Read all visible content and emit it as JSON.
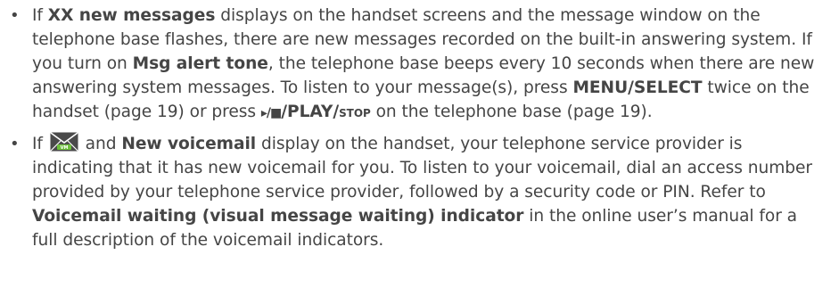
{
  "bullet_1": {
    "t1": "If ",
    "b1": "XX new messages",
    "t2": " displays on the handset screens and the message window on the telephone base flashes, there are new messages recorded on the built-in answering system. If you turn on ",
    "b2": "Msg alert tone",
    "t3": ", the telephone base beeps every 10 seconds when there are new answering system messages. To listen to your message(s), press ",
    "b3": "MENU/SELECT",
    "t4": " twice on the handset (page 19) or press ",
    "play_glyphs": "▸/■",
    "b4": "/PLAY/",
    "stop": "stop",
    "t5": " on the telephone base (page 19)."
  },
  "bullet_2": {
    "t1": "If ",
    "icon": "new-voicemail-envelope-icon",
    "t2": " and ",
    "b1": "New voicemail",
    "t3": " display on the handset, your telephone service provider is indicating that it has new voicemail for you. To listen to your voicemail, dial an access number provided by your telephone service provider, followed by a security code or PIN. Refer to ",
    "b2": "Voicemail waiting (visual message waiting) indicator",
    "t4": " in the online user’s manual for a full description of the voicemail indicators."
  },
  "colors": {
    "text": "#454545",
    "icon_bg": "#4a4a4a",
    "icon_accent": "#6cbf3a"
  }
}
